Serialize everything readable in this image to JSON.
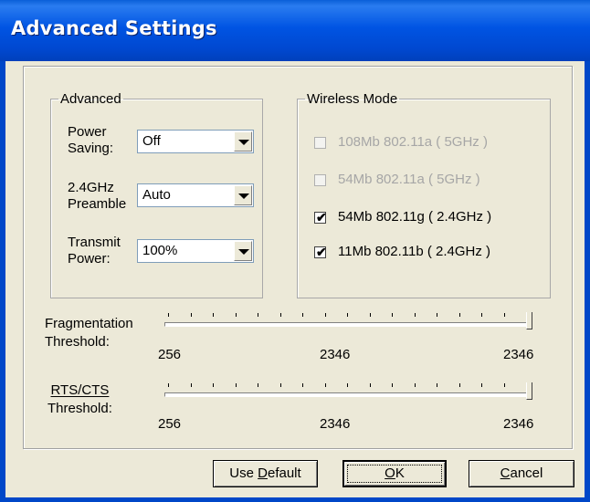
{
  "window": {
    "title": "Advanced Settings"
  },
  "advanced": {
    "legend": "Advanced",
    "power_saving": {
      "label_line1": "Power",
      "label_line2": "Saving:",
      "value": "Off"
    },
    "preamble": {
      "label_line1": "2.4GHz",
      "label_line2": "Preamble",
      "value": "Auto"
    },
    "transmit_power": {
      "label_line1": "Transmit",
      "label_line2": "Power:",
      "value": "100%"
    }
  },
  "wireless_mode": {
    "legend": "Wireless Mode",
    "options": [
      {
        "label": "108Mb 802.11a ( 5GHz )",
        "checked": false,
        "enabled": false
      },
      {
        "label": "54Mb 802.11a ( 5GHz )",
        "checked": false,
        "enabled": false
      },
      {
        "label": "54Mb 802.11g ( 2.4GHz )",
        "checked": true,
        "enabled": true
      },
      {
        "label": "11Mb 802.11b ( 2.4GHz )",
        "checked": true,
        "enabled": true
      }
    ]
  },
  "fragmentation": {
    "label_line1": "Fragmentation",
    "label_line2": "Threshold:",
    "min": "256",
    "current": "2346",
    "max": "2346"
  },
  "rts_cts": {
    "label_line1": "RTS/CTS",
    "label_line2": "Threshold:",
    "min": "256",
    "current": "2346",
    "max": "2346"
  },
  "buttons": {
    "use_default_prefix": "Use ",
    "use_default_accel": "D",
    "use_default_rest": "efault",
    "ok_accel": "O",
    "ok_rest": "K",
    "cancel_accel": "C",
    "cancel_rest": "ancel"
  }
}
